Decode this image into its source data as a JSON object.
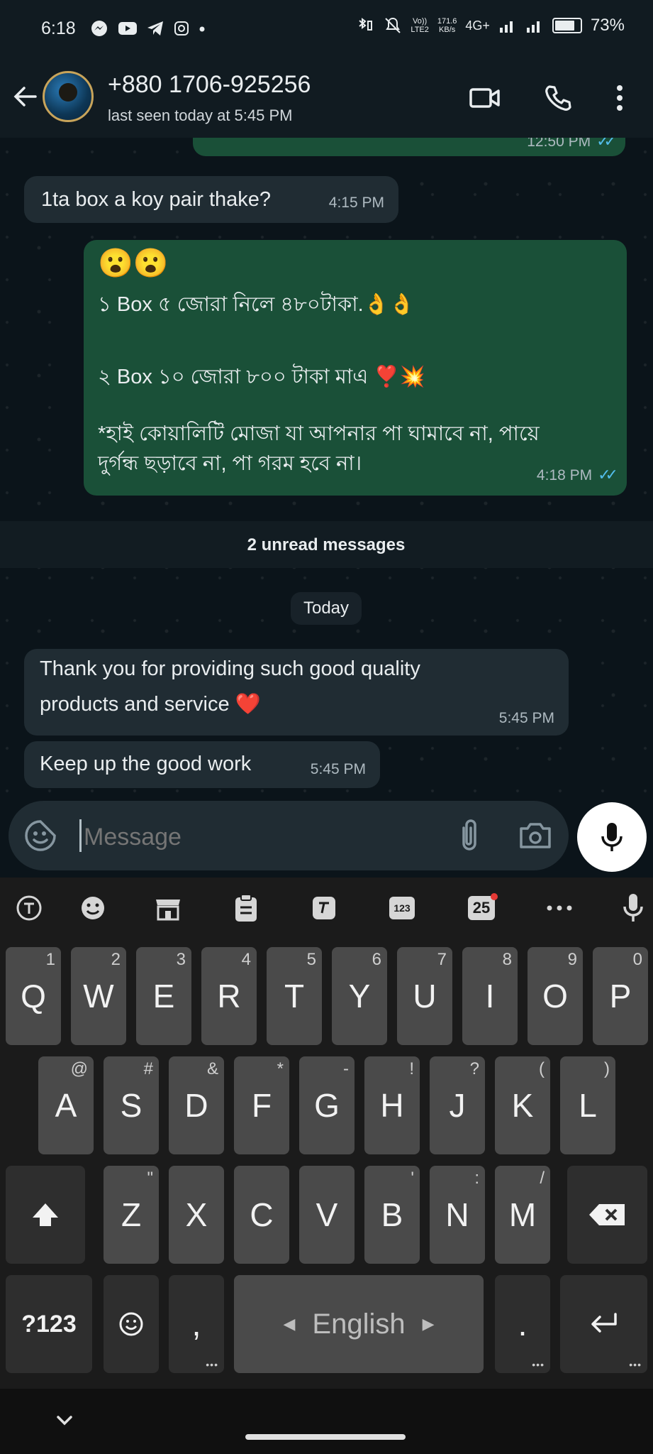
{
  "status_bar": {
    "time": "6:18",
    "net_line1": "171.6",
    "net_line2": "KB/s",
    "volte_line1": "Vo))",
    "volte_line2": "LTE2",
    "network": "4G+",
    "battery": "73%"
  },
  "header": {
    "contact": "+880 1706-925256",
    "last_seen": "last seen today at 5:45 PM"
  },
  "messages": [
    {
      "id": "m0",
      "dir": "out",
      "time": "12:50 PM"
    },
    {
      "id": "m1",
      "dir": "in",
      "text": "1ta box a koy pair thake?",
      "time": "4:15 PM"
    },
    {
      "id": "m2",
      "dir": "out",
      "emoji": "😮😮",
      "line1": "১ Box ৫ জোরা  নিলে  ৪৮০টাকা.👌👌",
      "line2": "২ Box ১০ জোরা  ৮০০ টাকা মাএ ❣️💥",
      "line3": "*হাই কোয়ালিটি মোজা যা আপনার পা ঘামাবে না, পায়ে",
      "line4": "দুর্গন্ধ ছড়াবে না, পা গরম হবে না।",
      "time": "4:18 PM"
    },
    {
      "id": "m3",
      "dir": "in",
      "line1": "Thank you for providing such good quality",
      "line2": "products and service ❤️",
      "time": "5:45 PM"
    },
    {
      "id": "m4",
      "dir": "in",
      "text": "Keep up the good work",
      "time": "5:45 PM"
    }
  ],
  "unread_label": "2 unread messages",
  "date_label": "Today",
  "composer": {
    "placeholder": "Message"
  },
  "keyboard": {
    "row1": [
      {
        "k": "Q",
        "h": "1"
      },
      {
        "k": "W",
        "h": "2"
      },
      {
        "k": "E",
        "h": "3"
      },
      {
        "k": "R",
        "h": "4"
      },
      {
        "k": "T",
        "h": "5"
      },
      {
        "k": "Y",
        "h": "6"
      },
      {
        "k": "U",
        "h": "7"
      },
      {
        "k": "I",
        "h": "8"
      },
      {
        "k": "O",
        "h": "9"
      },
      {
        "k": "P",
        "h": "0"
      }
    ],
    "row2": [
      {
        "k": "A",
        "h": "@"
      },
      {
        "k": "S",
        "h": "#"
      },
      {
        "k": "D",
        "h": "&"
      },
      {
        "k": "F",
        "h": "*"
      },
      {
        "k": "G",
        "h": "-"
      },
      {
        "k": "H",
        "h": "!"
      },
      {
        "k": "J",
        "h": "?"
      },
      {
        "k": "K",
        "h": "("
      },
      {
        "k": "L",
        "h": ")"
      }
    ],
    "row3": [
      {
        "k": "Z",
        "h": "\""
      },
      {
        "k": "X",
        "h": ""
      },
      {
        "k": "C",
        "h": ""
      },
      {
        "k": "V",
        "h": ""
      },
      {
        "k": "B",
        "h": "'"
      },
      {
        "k": "N",
        "h": ":"
      },
      {
        "k": "M",
        "h": "/"
      }
    ],
    "symbols_key": "?123",
    "comma_key": ",",
    "period_key": ".",
    "space_label": "English",
    "number_row_badge": "123",
    "calendar_badge": "25"
  },
  "colors": {
    "background": "#0b141a",
    "incoming_bubble": "#202c33",
    "outgoing_bubble": "#1a5038",
    "read_ticks": "#53bdeb",
    "keyboard_bg": "#1b1b1b",
    "key_bg": "#4a4a4a"
  }
}
